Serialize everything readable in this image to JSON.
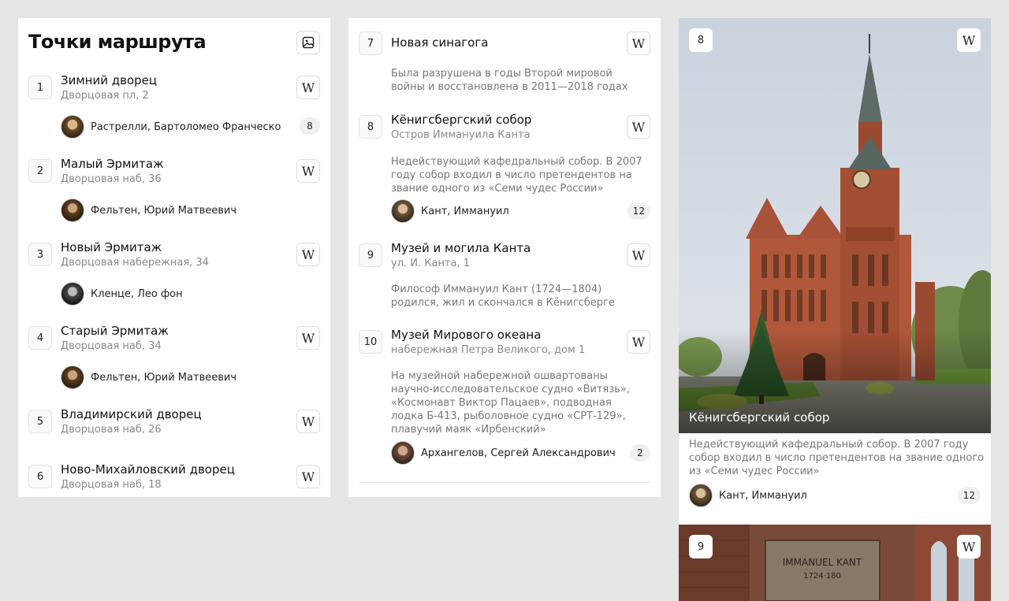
{
  "panel1": {
    "title": "Точки маршрута",
    "items": [
      {
        "num": "1",
        "name": "Зимний дворец",
        "address": "Дворцовая пл, 2",
        "person": "Растрелли, Бартоломео Франческо",
        "count": "8"
      },
      {
        "num": "2",
        "name": "Малый Эрмитаж",
        "address": "Дворцовая наб, 36",
        "person": "Фельтен, Юрий Матвеевич"
      },
      {
        "num": "3",
        "name": "Новый Эрмитаж",
        "address": "Дворцовая набережная, 34",
        "person": "Кленце, Лео фон"
      },
      {
        "num": "4",
        "name": "Старый Эрмитаж",
        "address": "Дворцовая наб, 34",
        "person": "Фельтен, Юрий Матвеевич"
      },
      {
        "num": "5",
        "name": "Владимирский дворец",
        "address": "Дворцовая наб, 26"
      },
      {
        "num": "6",
        "name": "Ново-Михайловский дворец",
        "address": "Дворцовая наб, 18"
      }
    ]
  },
  "panel2": {
    "items": [
      {
        "num": "7",
        "name": "Новая синагога",
        "description": "Была разрушена в годы Второй мировой войны и восстановлена в 2011—2018 годах"
      },
      {
        "num": "8",
        "name": "Кёнигсбергский собор",
        "address": "Остров Иммануила Канта",
        "description": "Недействующий кафедральный собор. В 2007 году собор входил в число претендентов на звание одного из «Семи чудес России»",
        "person": "Кант, Иммануил",
        "count": "12"
      },
      {
        "num": "9",
        "name": "Музей и могила Канта",
        "address": "ул. И. Канта, 1",
        "description": "Философ Иммануил Кант (1724—1804) родился, жил и скончался в Кёнигсберге"
      },
      {
        "num": "10",
        "name": "Музей Мирового океана",
        "address": "набережная Петра Великого, дом 1",
        "description": "На музейной набережной ошвартованы научно-исследовательское судно «Витязь», «Космонавт Виктор Пацаев», подводная лодка Б-413, рыболовное судно «СРТ-129», плавучий маяк «Ирбенский»",
        "person": "Архангелов, Сергей Александрович",
        "count": "2"
      }
    ]
  },
  "card": {
    "num": "8",
    "title": "Кёнигсбергский собор",
    "description": "Недействующий кафедральный собор. В 2007 году собор входил в число претендентов на звание одного из «Семи чудес России»",
    "person": "Кант, Иммануил",
    "count": "12",
    "next_num": "9",
    "next_plaque": "IMMANUEL KANT",
    "next_plaque_years": "1724·180"
  },
  "icons": {
    "wiki": "W",
    "image": "image-icon"
  }
}
